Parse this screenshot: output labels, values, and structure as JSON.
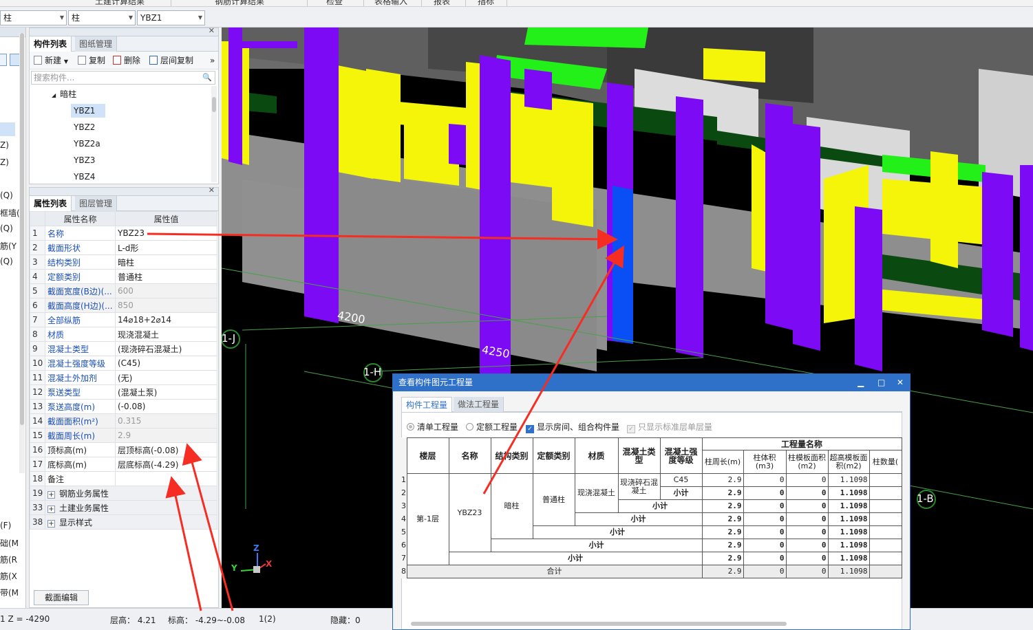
{
  "menu": {
    "items": [
      "土建计算结果",
      "钢筋计算结果",
      "检查",
      "表格输入",
      "报表",
      "指标"
    ]
  },
  "combos": [
    {
      "value": "柱"
    },
    {
      "value": "柱"
    },
    {
      "value": "YBZ1"
    }
  ],
  "left_strip": {
    "labels": [
      "Z)",
      "Z)",
      "(Q)",
      "框墙(",
      "(Q)",
      "筋(Y",
      "(Q)",
      "(F)",
      "础(M",
      "筋(R",
      "筋(X",
      "带(M",
      "1 Z = -4290"
    ]
  },
  "component_panel": {
    "tabs": [
      "构件列表",
      "图纸管理"
    ],
    "toolbar": {
      "new": "新建",
      "copy": "复制",
      "delete": "删除",
      "floor_copy": "层间复制",
      "more": "»"
    },
    "search_placeholder": "搜索构件...",
    "tree": {
      "group": "暗柱",
      "items": [
        "YBZ1",
        "YBZ2",
        "YBZ2a",
        "YBZ3",
        "YBZ4"
      ]
    }
  },
  "property_panel": {
    "tabs": [
      "属性列表",
      "图层管理"
    ],
    "headers": {
      "name": "属性名称",
      "value": "属性值"
    },
    "rows": [
      {
        "n": "1",
        "k": "名称",
        "v": "YBZ23"
      },
      {
        "n": "2",
        "k": "截面形状",
        "v": "L-d形"
      },
      {
        "n": "3",
        "k": "结构类别",
        "v": "暗柱"
      },
      {
        "n": "4",
        "k": "定额类别",
        "v": "普通柱"
      },
      {
        "n": "5",
        "k": "截面宽度(B边)(...",
        "v": "600"
      },
      {
        "n": "6",
        "k": "截面高度(H边)(...",
        "v": "850"
      },
      {
        "n": "7",
        "k": "全部纵筋",
        "v": "14⌀18+2⌀14"
      },
      {
        "n": "8",
        "k": "材质",
        "v": "现浇混凝土"
      },
      {
        "n": "9",
        "k": "混凝土类型",
        "v": "(现浇碎石混凝土)"
      },
      {
        "n": "10",
        "k": "混凝土强度等级",
        "v": "(C45)"
      },
      {
        "n": "11",
        "k": "混凝土外加剂",
        "v": "(无)"
      },
      {
        "n": "12",
        "k": "泵送类型",
        "v": "(混凝土泵)"
      },
      {
        "n": "13",
        "k": "泵送高度(m)",
        "v": "(-0.08)"
      },
      {
        "n": "14",
        "k": "截面面积(m²)",
        "v": "0.315"
      },
      {
        "n": "15",
        "k": "截面周长(m)",
        "v": "2.9"
      },
      {
        "n": "16",
        "k": "顶标高(m)",
        "v": "层顶标高(-0.08)"
      },
      {
        "n": "17",
        "k": "底标高(m)",
        "v": "层底标高(-4.29)"
      },
      {
        "n": "18",
        "k": "备注",
        "v": ""
      },
      {
        "n": "19",
        "k": "钢筋业务属性",
        "v": ""
      },
      {
        "n": "33",
        "k": "土建业务属性",
        "v": ""
      },
      {
        "n": "38",
        "k": "显示样式",
        "v": ""
      }
    ],
    "section_edit": "截面编辑"
  },
  "status": {
    "floor_height": "层高： 4.21",
    "elevation": "标高： -4.29~-0.08",
    "count": "1(2)",
    "hidden": "隐藏：0"
  },
  "view3d": {
    "dim1": "4200",
    "dim2": "4250",
    "axis_labels": [
      "1-J",
      "1-H",
      "1-B"
    ],
    "axes": [
      "Z",
      "Y",
      "X"
    ]
  },
  "dialog": {
    "title": "查看构件图元工程量",
    "window_buttons": [
      "▁",
      "□",
      "✕"
    ],
    "tabs": [
      "构件工程量",
      "做法工程量"
    ],
    "options": {
      "qd": "清单工程量",
      "de": "定额工程量",
      "show_room": "显示房间、组合构件量",
      "only_std": "只显示标准层单层量"
    },
    "headers": {
      "floor": "楼层",
      "name": "名称",
      "struct": "结构类别",
      "quota": "定额类别",
      "material": "材质",
      "concrete": "混凝土类型",
      "grade": "混凝土强度等级",
      "group": "工程量名称",
      "perimeter": "柱周长(m)",
      "volume": "柱体积(m3)",
      "formwork": "柱模板面积(m2)",
      "high_formwork": "超高模板面积(m2)",
      "count": "柱数量("
    },
    "cells": {
      "floor": "第-1层",
      "name": "YBZ23",
      "struct": "暗柱",
      "quota": "普通柱",
      "material": "现浇混凝土",
      "concrete": "现浇碎石混凝土",
      "grade": "C45",
      "subtotal": "小计",
      "total": "合计"
    },
    "values": {
      "perimeter": "2.9",
      "volume": "0",
      "formwork": "0",
      "high_formwork": "1.1098"
    },
    "row_numbers": [
      "1",
      "2",
      "3",
      "4",
      "5",
      "6",
      "7",
      "8"
    ]
  },
  "colors": {
    "column_purple": "#7d0af5",
    "wall_yellow": "#f5f50a",
    "slab_green": "#24f019",
    "highlight_blue": "#0a4ff5",
    "wall_grey": "#8c8c8c",
    "dialog_blue": "#2f70c8",
    "arrow_red": "#f52d23"
  }
}
